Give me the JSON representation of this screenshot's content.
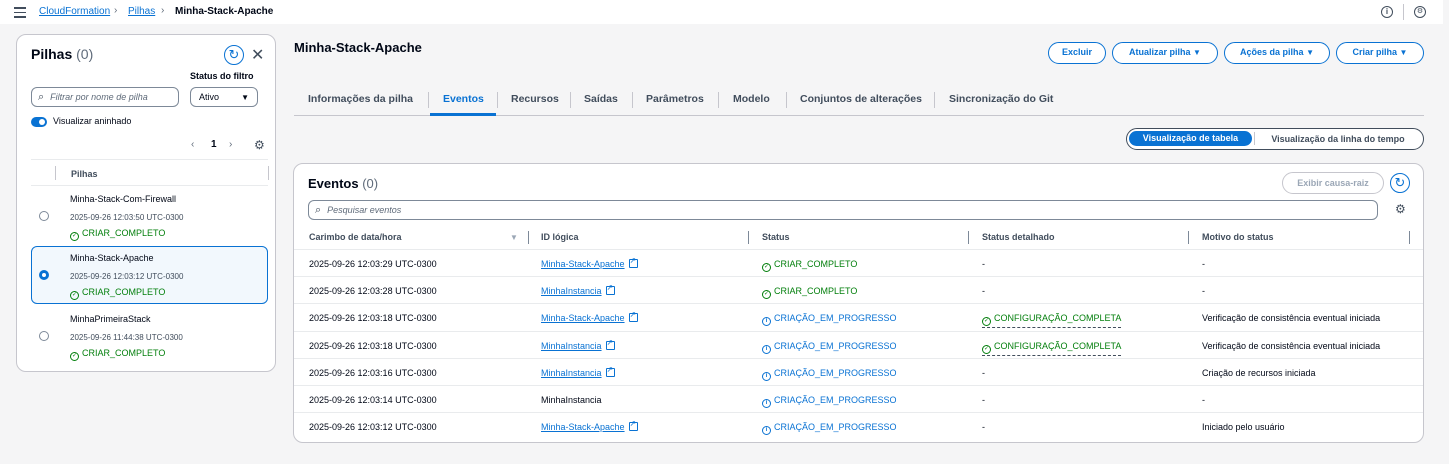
{
  "breadcrumb": {
    "root": "CloudFormation",
    "section": "Pilhas",
    "current": "Minha-Stack-Apache"
  },
  "topbar": {
    "info_icon": "info-icon",
    "settings_icon": "settings-icon"
  },
  "left": {
    "title": "Pilhas",
    "count": "(0)",
    "filter_label": "Status do filtro",
    "search_placeholder": "Filtrar por nome de pilha",
    "filter_value": "Ativo",
    "toggle_label": "Visualizar aninhado",
    "page": "1",
    "column": "Pilhas",
    "stacks": [
      {
        "name": "Minha-Stack-Com-Firewall",
        "time": "2025-09-26 12:03:50 UTC-0300",
        "status": "CRIAR_COMPLETO",
        "selected": false
      },
      {
        "name": "Minha-Stack-Apache",
        "time": "2025-09-26 12:03:12 UTC-0300",
        "status": "CRIAR_COMPLETO",
        "selected": true
      },
      {
        "name": "MinhaPrimeiraStack",
        "time": "2025-09-26 11:44:38 UTC-0300",
        "status": "CRIAR_COMPLETO",
        "selected": false
      }
    ]
  },
  "main": {
    "title": "Minha-Stack-Apache",
    "buttons": {
      "delete": "Excluir",
      "update": "Atualizar pilha",
      "actions": "Ações da pilha",
      "create": "Criar pilha"
    },
    "tabs": [
      "Informações da pilha",
      "Eventos",
      "Recursos",
      "Saídas",
      "Parâmetros",
      "Modelo",
      "Conjuntos de alterações",
      "Sincronização do Git"
    ],
    "active_tab": "Eventos",
    "view_toggle": {
      "table": "Visualização de tabela",
      "timeline": "Visualização da linha do tempo"
    },
    "events": {
      "title": "Eventos",
      "count": "(0)",
      "root_cause_button": "Exibir causa-raiz",
      "search_placeholder": "Pesquisar eventos",
      "columns": [
        "Carimbo de data/hora",
        "ID lógica",
        "Status",
        "Status detalhado",
        "Motivo do status"
      ],
      "rows": [
        {
          "time": "2025-09-26 12:03:29 UTC-0300",
          "id": "Minha-Stack-Apache",
          "id_link": true,
          "status": "CRIAR_COMPLETO",
          "status_kind": "ok",
          "detail": "-",
          "detail_kind": "none",
          "reason": "-"
        },
        {
          "time": "2025-09-26 12:03:28 UTC-0300",
          "id": "MinhaInstancia",
          "id_link": true,
          "status": "CRIAR_COMPLETO",
          "status_kind": "ok",
          "detail": "-",
          "detail_kind": "none",
          "reason": "-"
        },
        {
          "time": "2025-09-26 12:03:18 UTC-0300",
          "id": "Minha-Stack-Apache",
          "id_link": true,
          "status": "CRIAÇÃO_EM_PROGRESSO",
          "status_kind": "info",
          "detail": "CONFIGURAÇÃO_COMPLETA",
          "detail_kind": "ok",
          "reason": "Verificação de consistência eventual iniciada"
        },
        {
          "time": "2025-09-26 12:03:18 UTC-0300",
          "id": "MinhaInstancia",
          "id_link": true,
          "status": "CRIAÇÃO_EM_PROGRESSO",
          "status_kind": "info",
          "detail": "CONFIGURAÇÃO_COMPLETA",
          "detail_kind": "ok",
          "reason": "Verificação de consistência eventual iniciada"
        },
        {
          "time": "2025-09-26 12:03:16 UTC-0300",
          "id": "MinhaInstancia",
          "id_link": true,
          "status": "CRIAÇÃO_EM_PROGRESSO",
          "status_kind": "info",
          "detail": "-",
          "detail_kind": "none",
          "reason": "Criação de recursos iniciada"
        },
        {
          "time": "2025-09-26 12:03:14 UTC-0300",
          "id": "MinhaInstancia",
          "id_link": false,
          "status": "CRIAÇÃO_EM_PROGRESSO",
          "status_kind": "info",
          "detail": "-",
          "detail_kind": "none",
          "reason": "-"
        },
        {
          "time": "2025-09-26 12:03:12 UTC-0300",
          "id": "Minha-Stack-Apache",
          "id_link": true,
          "status": "CRIAÇÃO_EM_PROGRESSO",
          "status_kind": "info",
          "detail": "-",
          "detail_kind": "none",
          "reason": "Iniciado pelo usuário"
        }
      ]
    }
  },
  "colors": {
    "accent": "#0972d3",
    "success": "#037f0c",
    "text": "#000716",
    "background": "#f5f5f6"
  }
}
